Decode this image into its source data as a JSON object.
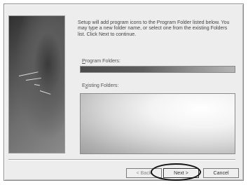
{
  "dialog": {
    "intro_text": "Setup will add program icons to the Program Folder listed below. You may type a new folder name, or select one from the existing Folders list.  Click Next to continue.",
    "program_folders_label_accel": "P",
    "program_folders_label_rest": "rogram Folders:",
    "program_folder_value": "",
    "existing_folders_label_prefix": "E",
    "existing_folders_label_accel": "x",
    "existing_folders_label_rest": "isting Folders:",
    "existing_folders_items": []
  },
  "buttons": {
    "back_label": "< Back",
    "next_label": "Next >",
    "cancel_label": "Cancel"
  },
  "colors": {
    "window_bg": "#ededed",
    "highlight": "#111111"
  }
}
